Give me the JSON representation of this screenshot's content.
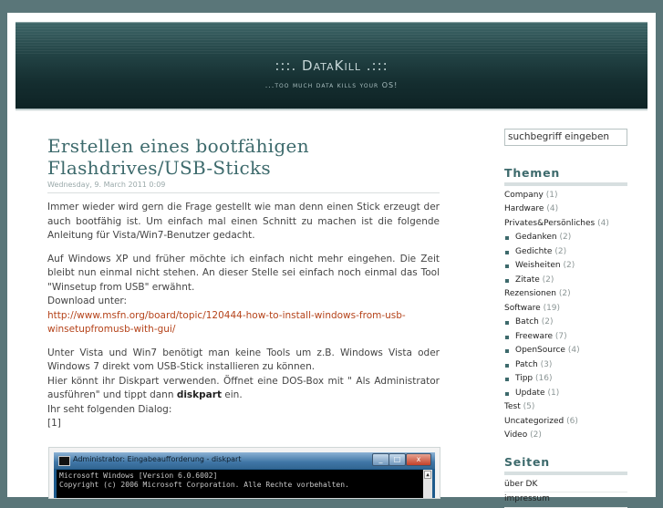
{
  "site": {
    "title": ":::. DataKill .:::",
    "tagline": "...too much data kills your OS!"
  },
  "post": {
    "title": "Erstellen eines bootfähigen Flashdrives/USB-Sticks",
    "date": "Wednesday, 9. March 2011 0:09",
    "p1": "Immer wieder wird gern die Frage gestellt wie man denn einen Stick erzeugt der auch bootfähig ist. Um einfach mal einen Schnitt zu machen ist die folgende Anleitung für Vista/Win7-Benutzer gedacht.",
    "p2a": "Auf Windows XP und früher möchte ich einfach nicht mehr eingehen. Die Zeit bleibt nun einmal nicht stehen. An dieser Stelle sei einfach noch einmal das Tool \"Winsetup from USB\" erwähnt.",
    "p2b": "Download unter:",
    "p2link": "http://www.msfn.org/board/topic/120444-how-to-install-windows-from-usb-winsetupfromusb-with-gui/",
    "p3a": "Unter Vista und Win7 benötigt man keine Tools um z.B. Windows Vista oder Windows 7 direkt vom USB-Stick installieren zu können.",
    "p3b_pre": "Hier könnt ihr Diskpart verwenden. Öffnet eine DOS-Box mit \" Als Administrator ausführen\" und tippt dann ",
    "p3b_bold": "diskpart",
    "p3b_post": " ein.",
    "p3c": "Ihr seht folgenden Dialog:",
    "p3d": "[1]"
  },
  "screenshot": {
    "window_title": "Administrator: Eingabeaufforderung - diskpart",
    "line1": "Microsoft Windows [Version 6.0.6002]",
    "line2": "Copyright (c) 2006 Microsoft Corporation. Alle Rechte vorbehalten.",
    "btn_min": "_",
    "btn_max": "□",
    "btn_close": "x",
    "scroll_up": "▲"
  },
  "sidebar": {
    "search_placeholder": "suchbegriff eingeben",
    "themen_heading": "Themen",
    "seiten_heading": "Seiten",
    "categories": [
      {
        "label": "Company",
        "count": "(1)"
      },
      {
        "label": "Hardware",
        "count": "(4)"
      },
      {
        "label": "Privates&Persönliches",
        "count": "(4)"
      },
      {
        "label": "Gedanken",
        "count": "(2)"
      },
      {
        "label": "Gedichte",
        "count": "(2)"
      },
      {
        "label": "Weisheiten",
        "count": "(2)"
      },
      {
        "label": "Zitate",
        "count": "(2)"
      },
      {
        "label": "Rezensionen",
        "count": "(2)"
      },
      {
        "label": "Software",
        "count": "(19)"
      },
      {
        "label": "Batch",
        "count": "(2)"
      },
      {
        "label": "Freeware",
        "count": "(7)"
      },
      {
        "label": "OpenSource",
        "count": "(4)"
      },
      {
        "label": "Patch",
        "count": "(3)"
      },
      {
        "label": "Tipp",
        "count": "(16)"
      },
      {
        "label": "Update",
        "count": "(1)"
      },
      {
        "label": "Test",
        "count": "(5)"
      },
      {
        "label": "Uncategorized",
        "count": "(6)"
      },
      {
        "label": "Video",
        "count": "(2)"
      }
    ],
    "pages": [
      {
        "label": "über DK"
      },
      {
        "label": "impressum"
      }
    ]
  }
}
